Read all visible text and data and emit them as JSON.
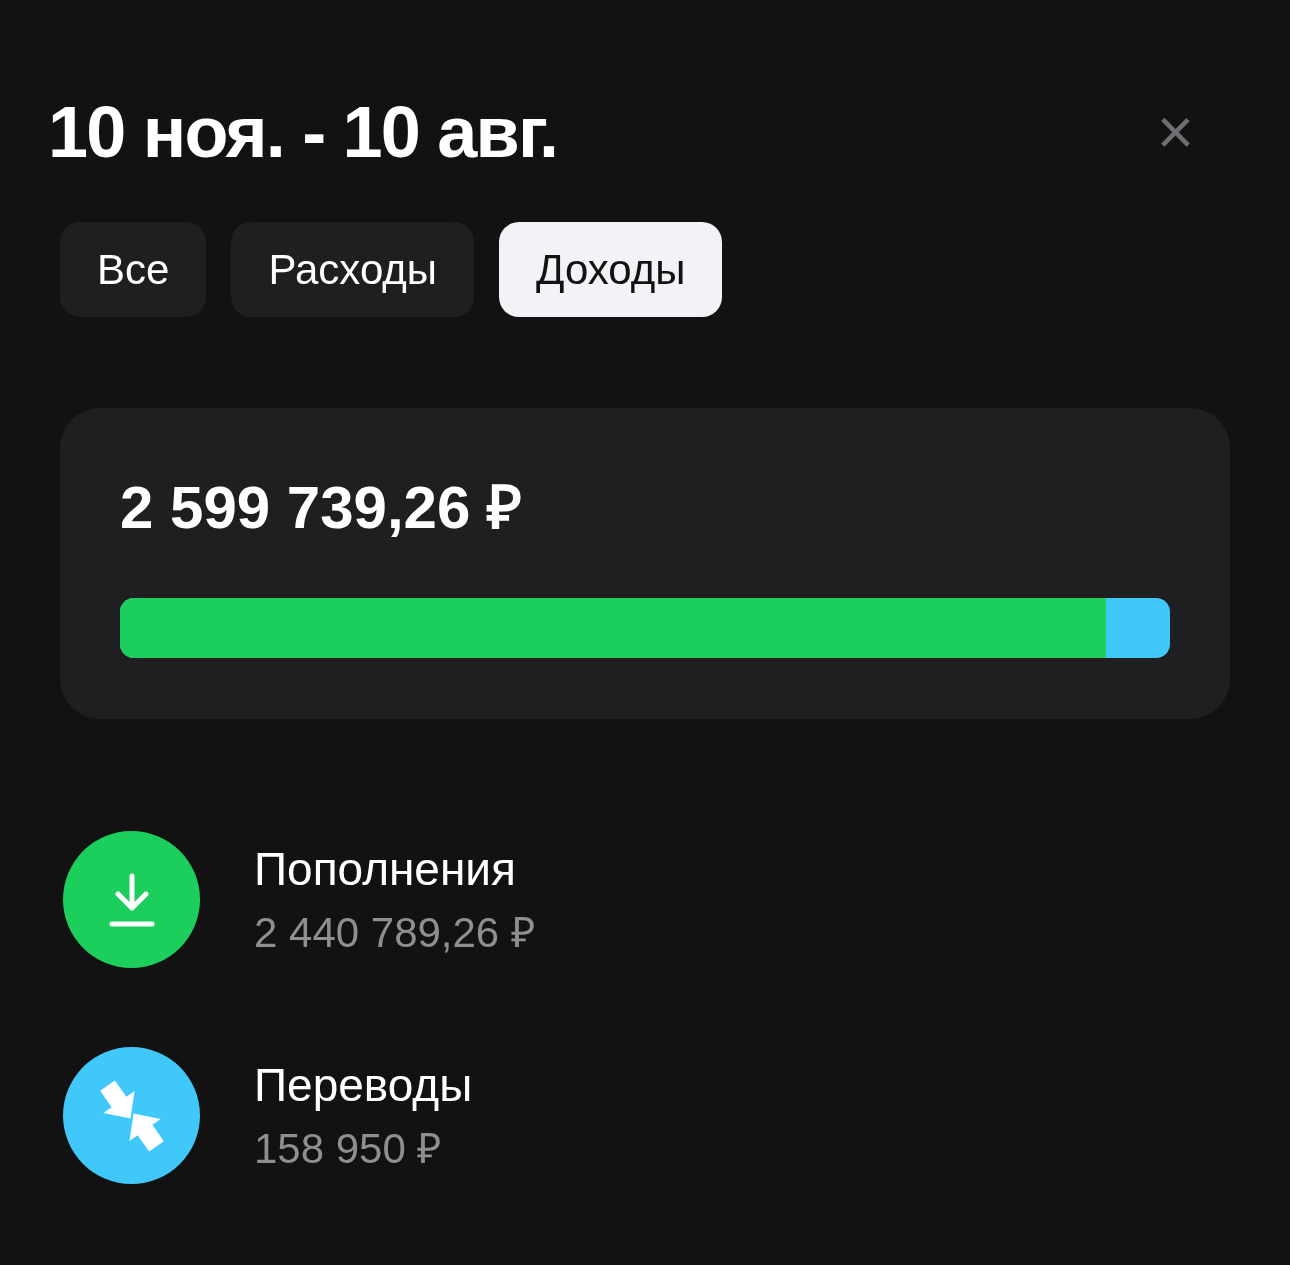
{
  "title": "10 ноя. - 10 авг.",
  "close": "×",
  "tabs": [
    {
      "label": "Все",
      "selected": false
    },
    {
      "label": "Расходы",
      "selected": false
    },
    {
      "label": "Доходы",
      "selected": true
    }
  ],
  "summary": {
    "total": "2 599 739,26 ₽",
    "level": 0.939
  },
  "categories": [
    {
      "kind": "deposit",
      "name": "Пополнения",
      "amount": "2 440 789,26 ₽",
      "color": "#1ccf5c"
    },
    {
      "kind": "transfer",
      "name": "Переводы",
      "amount": "158 950 ₽",
      "color": "#40c8fb"
    }
  ]
}
